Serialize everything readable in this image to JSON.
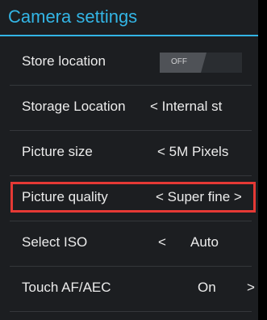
{
  "header": {
    "title": "Camera settings"
  },
  "rows": [
    {
      "label": "Store location",
      "toggle_text": "OFF"
    },
    {
      "label": "Storage Location",
      "value": "< Internal st"
    },
    {
      "label": "Picture size",
      "value": "< 5M Pixels"
    },
    {
      "label": "Picture quality",
      "value": "< Super fine >"
    },
    {
      "label": "Select ISO",
      "prev": "<",
      "value": "Auto"
    },
    {
      "label": "Touch AF/AEC",
      "value": "On",
      "next": ">"
    }
  ],
  "colors": {
    "accent": "#33b5e5",
    "highlight": "#e53935",
    "background": "#1c1e21",
    "text": "#ececec"
  }
}
